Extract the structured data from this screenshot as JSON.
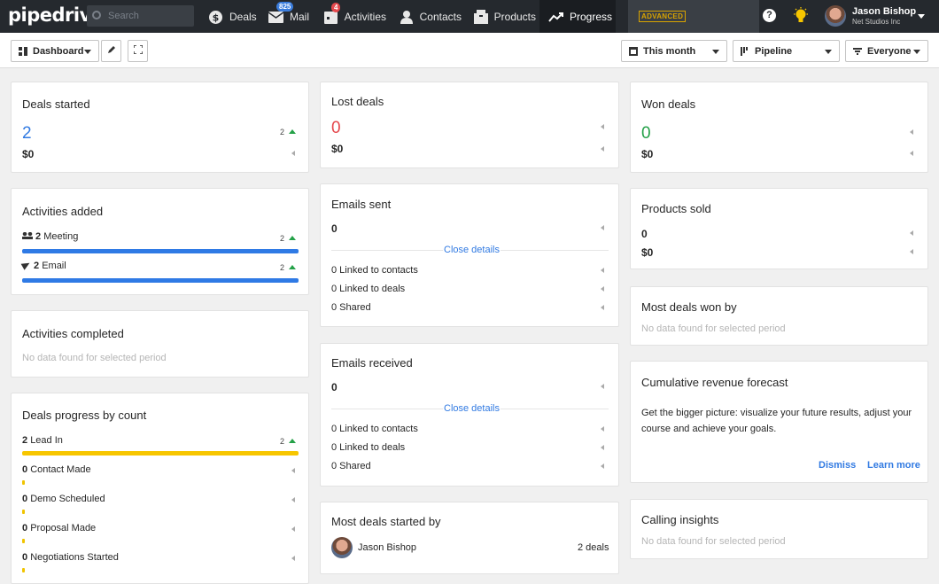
{
  "app": {
    "logo": "pipedrive",
    "search_placeholder": "Search",
    "user_name": "Jason Bishop",
    "user_company": "Net Studios Inc",
    "advanced_label": "ADVANCED",
    "help_label": "?"
  },
  "nav": [
    {
      "label": "Deals",
      "icon": "dollar-icon"
    },
    {
      "label": "Mail",
      "icon": "mail-icon",
      "badge": "825"
    },
    {
      "label": "Activities",
      "icon": "calendar-icon",
      "badge": "4"
    },
    {
      "label": "Contacts",
      "icon": "person-icon"
    },
    {
      "label": "Products",
      "icon": "box-icon"
    },
    {
      "label": "Progress",
      "icon": "trend-icon",
      "active": true
    }
  ],
  "toolbar": {
    "dashboard": "Dashboard",
    "period": "This month",
    "pipeline": "Pipeline",
    "owner": "Everyone"
  },
  "colors": {
    "blue": "#317ae2",
    "red": "#e5484d",
    "green": "#24a148",
    "yellow": "#f7c600",
    "bar_blue": "#2f7ae5"
  },
  "deals_started": {
    "title": "Deals started",
    "count": "2",
    "value": "$0",
    "trend": "2"
  },
  "activities_added": {
    "title": "Activities added",
    "rows": [
      {
        "num": "2",
        "label": "Meeting",
        "trend": "2",
        "progress": 1.0
      },
      {
        "num": "2",
        "label": "Email",
        "trend": "2",
        "progress": 1.0
      }
    ]
  },
  "activities_completed": {
    "title": "Activities completed",
    "empty": "No data found for selected period"
  },
  "deals_progress": {
    "title": "Deals progress by count",
    "rows": [
      {
        "num": "2",
        "label": "Lead In",
        "trend": "2",
        "progress": 1.0
      },
      {
        "num": "0",
        "label": "Contact Made",
        "progress": 0
      },
      {
        "num": "0",
        "label": "Demo Scheduled",
        "progress": 0
      },
      {
        "num": "0",
        "label": "Proposal Made",
        "progress": 0
      },
      {
        "num": "0",
        "label": "Negotiations Started",
        "progress": 0
      }
    ]
  },
  "lost_deals": {
    "title": "Lost deals",
    "count": "0",
    "value": "$0"
  },
  "emails_sent": {
    "title": "Emails sent",
    "count": "0",
    "close": "Close details",
    "rows": [
      "0 Linked to contacts",
      "0 Linked to deals",
      "0 Shared"
    ]
  },
  "emails_received": {
    "title": "Emails received",
    "count": "0",
    "close": "Close details",
    "rows": [
      "0 Linked to contacts",
      "0 Linked to deals",
      "0 Shared"
    ]
  },
  "most_deals_started": {
    "title": "Most deals started by",
    "person": "Jason Bishop",
    "deals": "2 deals"
  },
  "won_deals": {
    "title": "Won deals",
    "count": "0",
    "value": "$0"
  },
  "products_sold": {
    "title": "Products sold",
    "count": "0",
    "value": "$0"
  },
  "most_deals_won": {
    "title": "Most deals won by",
    "empty": "No data found for selected period"
  },
  "forecast": {
    "title": "Cumulative revenue forecast",
    "text1": "Get the bigger picture: visualize your future results, adjust your",
    "text2": "course and achieve your goals.",
    "dismiss": "Dismiss",
    "learn": "Learn more"
  },
  "calling": {
    "title": "Calling insights",
    "empty": "No data found for selected period"
  }
}
